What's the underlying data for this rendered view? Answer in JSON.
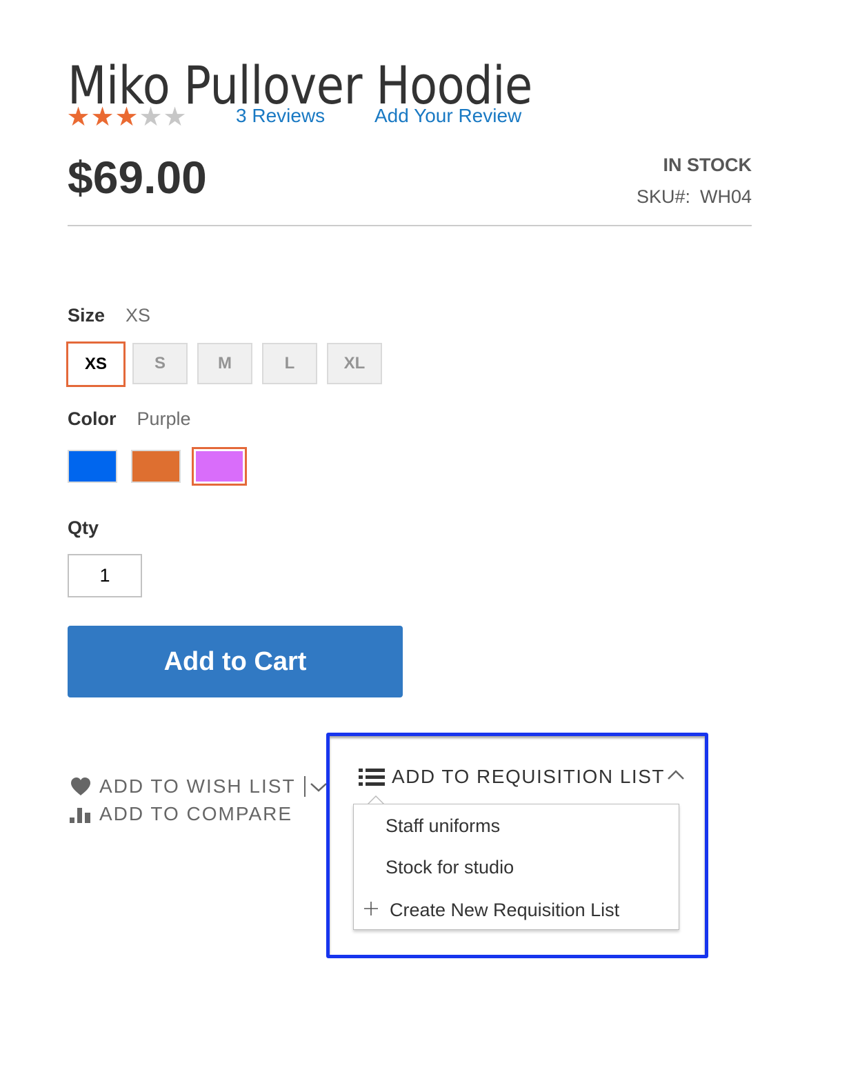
{
  "product": {
    "title": "Miko Pullover Hoodie",
    "rating": {
      "value": 3,
      "max": 5
    },
    "reviews_link": "3  Reviews",
    "add_review_link": "Add Your Review",
    "price": "$69.00",
    "stock_status": "IN STOCK",
    "sku_label": "SKU#:",
    "sku_value": "WH04"
  },
  "options": {
    "size": {
      "label": "Size",
      "selected": "XS",
      "choices": [
        "XS",
        "S",
        "M",
        "L",
        "XL"
      ]
    },
    "color": {
      "label": "Color",
      "selected": "Purple",
      "choices": [
        {
          "name": "Blue",
          "hex": "#0066ee"
        },
        {
          "name": "Orange",
          "hex": "#de6f30"
        },
        {
          "name": "Purple",
          "hex": "#d96dfa"
        }
      ]
    }
  },
  "qty": {
    "label": "Qty",
    "value": "1"
  },
  "add_to_cart_label": "Add to Cart",
  "actions": {
    "wish_list": "ADD TO WISH LIST",
    "compare": "ADD TO COMPARE"
  },
  "requisition": {
    "label": "ADD TO REQUISITION LIST",
    "items": [
      "Staff uniforms",
      "Stock for studio"
    ],
    "create_label": "Create New Requisition List"
  },
  "colors": {
    "accent_link": "#1979c3",
    "star_on": "#ea6a32",
    "star_off": "#c7c7c7",
    "selected_border": "#e4693a",
    "primary_button": "#3179c3",
    "highlight_border": "#1735ee"
  }
}
